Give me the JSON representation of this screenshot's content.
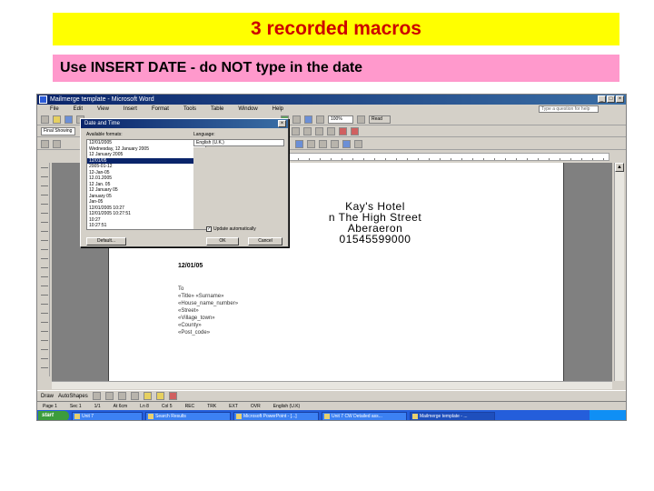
{
  "header": {
    "title": "3 recorded macros",
    "subtitle": "Use INSERT DATE  - do NOT type in the date"
  },
  "colors": {
    "title_bg": "#ffff00",
    "title_text": "#cc0000",
    "subtitle_bg": "#ff99cc"
  },
  "screenshot": {
    "window_title": "Mailmerge template - Microsoft Word",
    "menu": [
      "File",
      "Edit",
      "View",
      "Insert",
      "Format",
      "Tools",
      "Table",
      "Window",
      "Help"
    ],
    "help_placeholder": "Type a question for help",
    "style_combo": "Final Showing",
    "zoom_combo": "100%",
    "read_label": "Read",
    "dialog": {
      "title": "Date and Time",
      "formats_label": "Available formats:",
      "language_label": "Language:",
      "language_value": "English (U.K.)",
      "formats": [
        "12/01/2005",
        "Wednesday, 12 January 2005",
        "12 January 2005",
        "12/01/05",
        "2005-01-12",
        "12-Jan-05",
        "12.01.2005",
        "12 Jan. 05",
        "12 January 05",
        "January 05",
        "Jan-05",
        "12/01/2005 10:27",
        "12/01/2005 10:27:51",
        "10:27",
        "10:27:51"
      ],
      "selected_index": 3,
      "update_label": "Update automatically",
      "default_button": "Default...",
      "ok_button": "OK",
      "cancel_button": "Cancel"
    },
    "letterhead": [
      "Kay's Hotel",
      "n The High Street",
      "Aberaeron",
      "01545599000"
    ],
    "date_text": "12/01/05",
    "fields": [
      "To",
      "«Title» «Surname»",
      "«House_name_number»",
      "«Street»",
      "«Village_town»",
      "«County»",
      "«Post_code»"
    ],
    "draw_label": "Draw",
    "autoshapes_label": "AutoShapes",
    "status": [
      "Page 1",
      "Sec 1",
      "1/1",
      "At 6cm",
      "Ln 8",
      "Col 5",
      "REC",
      "TRK",
      "EXT",
      "OVR",
      "English (U.K)"
    ],
    "taskbar": {
      "start_label": "start",
      "items": [
        "Unit 7",
        "Search Results",
        "Microsoft PowerPoint - [...]",
        "Unit 7 CW Detailed ass...",
        "Mailmerge template - ..."
      ]
    }
  }
}
